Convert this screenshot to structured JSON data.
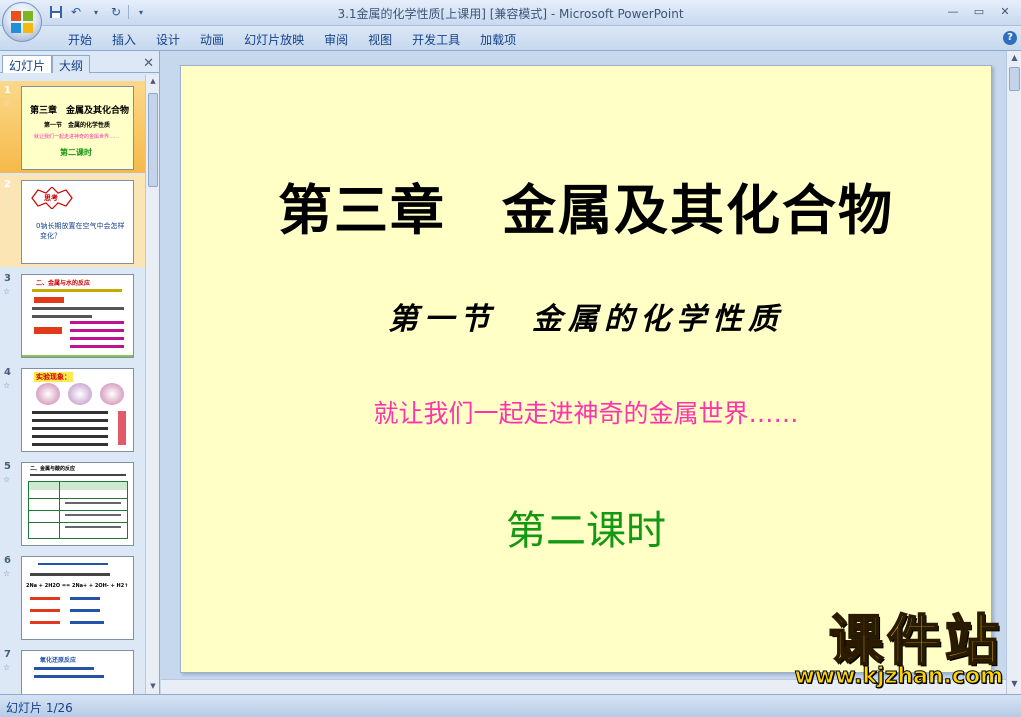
{
  "titlebar": {
    "title": "3.1金属的化学性质[上课用] [兼容模式] - Microsoft PowerPoint"
  },
  "ribbon": {
    "tabs": [
      "开始",
      "插入",
      "设计",
      "动画",
      "幻灯片放映",
      "审阅",
      "视图",
      "开发工具",
      "加载项"
    ]
  },
  "left_pane": {
    "tab_slides": "幻灯片",
    "tab_outline": "大纲",
    "thumbnails": [
      {
        "num": "1",
        "line1": "第三章　金属及其化合物",
        "line2": "第一节　金属的化学性质",
        "line3": "就让我们一起走进神奇的金属世界……",
        "line4": "第二课时"
      },
      {
        "num": "2",
        "line1": "思考",
        "line2": "0钠长期放置在空气中会怎样",
        "line3": "变化？"
      },
      {
        "num": "3",
        "line1": "二、金属与水的反应"
      },
      {
        "num": "4",
        "line1": "实验现象："
      },
      {
        "num": "5",
        "line1": "二、金属与酸的反应"
      },
      {
        "num": "6",
        "line1": "2Na + 2H2O == 2Na+ + 2OH- + H2↑"
      },
      {
        "num": "7",
        "line1": "氧化还原反应"
      }
    ]
  },
  "slide": {
    "title": "第三章　金属及其化合物",
    "subtitle": "第一节　金属的化学性质",
    "slogan": "就让我们一起走进神奇的金属世界……",
    "lesson": "第二课时"
  },
  "watermark": {
    "text": "课件站",
    "url": "www.kjzhan.com"
  },
  "statusbar": {
    "slide_count": "幻灯片 1/26"
  },
  "colors": {
    "slide_bg": "#ffffc6",
    "slogan": "#ff33aa",
    "lesson": "#129812",
    "selected_thumb": "#f6b94a"
  }
}
